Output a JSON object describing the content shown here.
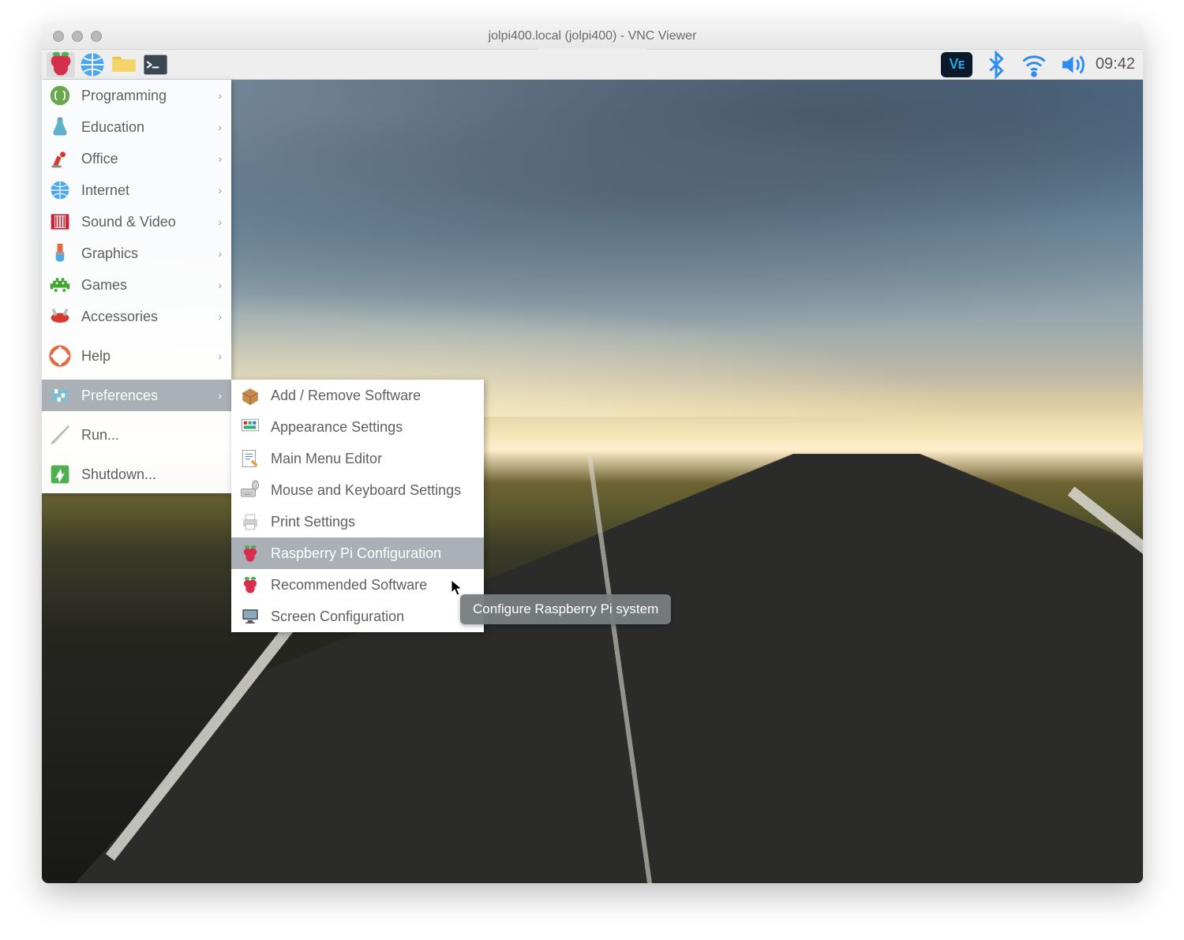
{
  "window": {
    "title": "jolpi400.local (jolpi400) - VNC Viewer"
  },
  "taskbar": {
    "clock": "09:42",
    "vnc_label": "Vᴇ"
  },
  "menu": {
    "items": [
      {
        "label": "Programming",
        "icon": "code"
      },
      {
        "label": "Education",
        "icon": "flask"
      },
      {
        "label": "Office",
        "icon": "lamp"
      },
      {
        "label": "Internet",
        "icon": "globe"
      },
      {
        "label": "Sound & Video",
        "icon": "film"
      },
      {
        "label": "Graphics",
        "icon": "brush"
      },
      {
        "label": "Games",
        "icon": "invader"
      },
      {
        "label": "Accessories",
        "icon": "knife"
      }
    ],
    "help": {
      "label": "Help"
    },
    "preferences": {
      "label": "Preferences"
    },
    "run": {
      "label": "Run..."
    },
    "shutdown": {
      "label": "Shutdown..."
    }
  },
  "submenu": {
    "items": [
      {
        "label": "Add / Remove Software"
      },
      {
        "label": "Appearance Settings"
      },
      {
        "label": "Main Menu Editor"
      },
      {
        "label": "Mouse and Keyboard Settings"
      },
      {
        "label": "Print Settings"
      },
      {
        "label": "Raspberry Pi Configuration"
      },
      {
        "label": "Recommended Software"
      },
      {
        "label": "Screen Configuration"
      }
    ],
    "hovered_index": 5
  },
  "tooltip": {
    "text": "Configure Raspberry Pi system"
  }
}
